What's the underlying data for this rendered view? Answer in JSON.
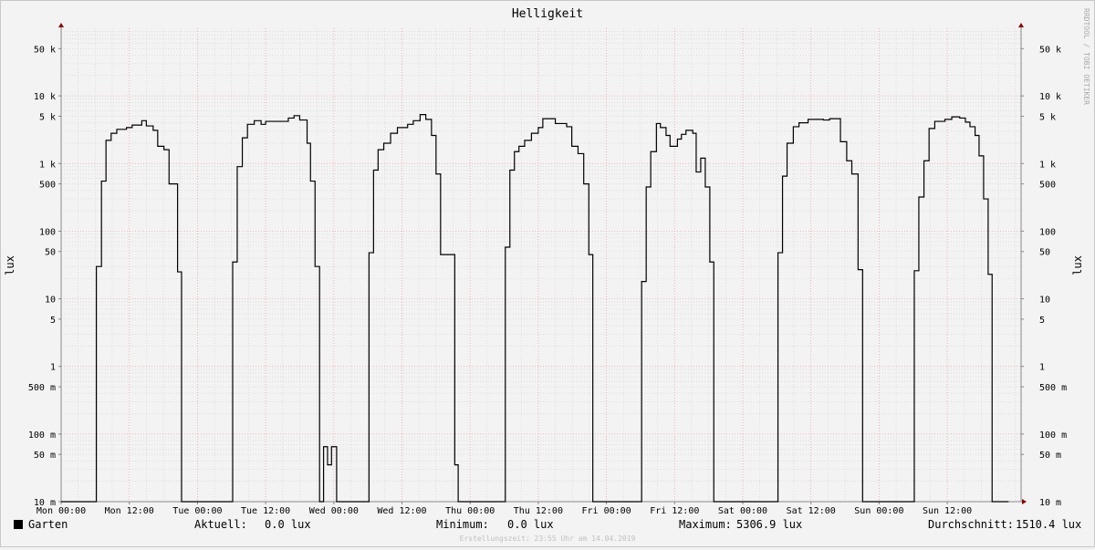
{
  "chart_data": {
    "type": "line",
    "title": "Helligkeit",
    "ylabel": "lux",
    "y_scale": "log",
    "ylim": [
      0.01,
      100000
    ],
    "y_ticks": [
      {
        "value": 0.01,
        "label": "10 m"
      },
      {
        "value": 0.05,
        "label": "50 m"
      },
      {
        "value": 0.1,
        "label": "100 m"
      },
      {
        "value": 0.5,
        "label": "500 m"
      },
      {
        "value": 1,
        "label": "1"
      },
      {
        "value": 5,
        "label": "5"
      },
      {
        "value": 10,
        "label": "10"
      },
      {
        "value": 50,
        "label": "50"
      },
      {
        "value": 100,
        "label": "100"
      },
      {
        "value": 500,
        "label": "500"
      },
      {
        "value": 1000,
        "label": "1 k"
      },
      {
        "value": 5000,
        "label": "5 k"
      },
      {
        "value": 10000,
        "label": "10 k"
      },
      {
        "value": 50000,
        "label": "50 k"
      }
    ],
    "x_ticks": [
      {
        "hours": 0,
        "label": "Mon 00:00"
      },
      {
        "hours": 12,
        "label": "Mon 12:00"
      },
      {
        "hours": 24,
        "label": "Tue 00:00"
      },
      {
        "hours": 36,
        "label": "Tue 12:00"
      },
      {
        "hours": 48,
        "label": "Wed 00:00"
      },
      {
        "hours": 60,
        "label": "Wed 12:00"
      },
      {
        "hours": 72,
        "label": "Thu 00:00"
      },
      {
        "hours": 84,
        "label": "Thu 12:00"
      },
      {
        "hours": 96,
        "label": "Fri 00:00"
      },
      {
        "hours": 108,
        "label": "Fri 12:00"
      },
      {
        "hours": 120,
        "label": "Sat 00:00"
      },
      {
        "hours": 132,
        "label": "Sat 12:00"
      },
      {
        "hours": 144,
        "label": "Sun 00:00"
      },
      {
        "hours": 156,
        "label": "Sun 12:00"
      }
    ],
    "xlim_hours": [
      0,
      169
    ],
    "grid": true,
    "series": [
      {
        "name": "Garten",
        "color": "#000000",
        "step": true,
        "points": [
          [
            0,
            0.01
          ],
          [
            6.2,
            0.01
          ],
          [
            6.2,
            30
          ],
          [
            7.1,
            30
          ],
          [
            7.1,
            550
          ],
          [
            7.9,
            550
          ],
          [
            7.9,
            2200
          ],
          [
            8.8,
            2200
          ],
          [
            8.8,
            2800
          ],
          [
            9.8,
            2800
          ],
          [
            9.8,
            3200
          ],
          [
            11.5,
            3200
          ],
          [
            11.5,
            3400
          ],
          [
            12.5,
            3400
          ],
          [
            12.5,
            3700
          ],
          [
            14.2,
            3700
          ],
          [
            14.2,
            4300
          ],
          [
            15.0,
            4300
          ],
          [
            15.0,
            3600
          ],
          [
            16.2,
            3600
          ],
          [
            16.2,
            3100
          ],
          [
            17.0,
            3100
          ],
          [
            17.0,
            1800
          ],
          [
            18.1,
            1800
          ],
          [
            18.1,
            1600
          ],
          [
            19.0,
            1600
          ],
          [
            19.0,
            500
          ],
          [
            20.5,
            500
          ],
          [
            20.5,
            25
          ],
          [
            21.2,
            25
          ],
          [
            21.2,
            0.01
          ],
          [
            30.2,
            0.01
          ],
          [
            30.2,
            35
          ],
          [
            31.0,
            35
          ],
          [
            31.0,
            900
          ],
          [
            31.9,
            900
          ],
          [
            31.9,
            2400
          ],
          [
            32.8,
            2400
          ],
          [
            32.8,
            3800
          ],
          [
            34.0,
            3800
          ],
          [
            34.0,
            4300
          ],
          [
            35.2,
            4300
          ],
          [
            35.2,
            3800
          ],
          [
            36.0,
            3800
          ],
          [
            36.0,
            4200
          ],
          [
            40.0,
            4200
          ],
          [
            40.0,
            4700
          ],
          [
            41.0,
            4700
          ],
          [
            41.0,
            5100
          ],
          [
            42.0,
            5100
          ],
          [
            42.0,
            4400
          ],
          [
            43.3,
            4400
          ],
          [
            43.3,
            2000
          ],
          [
            43.9,
            2000
          ],
          [
            43.9,
            550
          ],
          [
            44.7,
            550
          ],
          [
            44.7,
            30
          ],
          [
            45.5,
            30
          ],
          [
            45.5,
            0.01
          ],
          [
            46.2,
            0.01
          ],
          [
            46.2,
            0.065
          ],
          [
            46.9,
            0.065
          ],
          [
            46.9,
            0.035
          ],
          [
            47.6,
            0.035
          ],
          [
            47.6,
            0.065
          ],
          [
            48.5,
            0.065
          ],
          [
            48.5,
            0.01
          ],
          [
            54.2,
            0.01
          ],
          [
            54.2,
            48
          ],
          [
            55.0,
            48
          ],
          [
            55.0,
            800
          ],
          [
            55.8,
            800
          ],
          [
            55.8,
            1600
          ],
          [
            56.8,
            1600
          ],
          [
            56.8,
            2000
          ],
          [
            58.0,
            2000
          ],
          [
            58.0,
            2800
          ],
          [
            59.2,
            2800
          ],
          [
            59.2,
            3400
          ],
          [
            61.0,
            3400
          ],
          [
            61.0,
            3800
          ],
          [
            62.0,
            3800
          ],
          [
            62.0,
            4300
          ],
          [
            63.2,
            4300
          ],
          [
            63.2,
            5300
          ],
          [
            64.2,
            5300
          ],
          [
            64.2,
            4500
          ],
          [
            65.2,
            4500
          ],
          [
            65.2,
            2600
          ],
          [
            66.0,
            2600
          ],
          [
            66.0,
            700
          ],
          [
            66.8,
            700
          ],
          [
            66.8,
            45
          ],
          [
            69.3,
            45
          ],
          [
            69.3,
            0.035
          ],
          [
            69.9,
            0.035
          ],
          [
            69.9,
            0.01
          ],
          [
            78.2,
            0.01
          ],
          [
            78.2,
            58
          ],
          [
            79.0,
            58
          ],
          [
            79.0,
            800
          ],
          [
            79.8,
            800
          ],
          [
            79.8,
            1500
          ],
          [
            80.6,
            1500
          ],
          [
            80.6,
            1800
          ],
          [
            81.6,
            1800
          ],
          [
            81.6,
            2200
          ],
          [
            82.8,
            2200
          ],
          [
            82.8,
            2800
          ],
          [
            84.0,
            2800
          ],
          [
            84.0,
            3400
          ],
          [
            84.8,
            3400
          ],
          [
            84.8,
            4600
          ],
          [
            87.0,
            4600
          ],
          [
            87.0,
            3900
          ],
          [
            89.0,
            3900
          ],
          [
            89.0,
            3500
          ],
          [
            89.9,
            3500
          ],
          [
            89.9,
            1800
          ],
          [
            91.0,
            1800
          ],
          [
            91.0,
            1400
          ],
          [
            92.0,
            1400
          ],
          [
            92.0,
            500
          ],
          [
            92.9,
            500
          ],
          [
            92.9,
            45
          ],
          [
            93.6,
            45
          ],
          [
            93.6,
            0.01
          ],
          [
            102.2,
            0.01
          ],
          [
            102.2,
            18
          ],
          [
            103.0,
            18
          ],
          [
            103.0,
            450
          ],
          [
            103.8,
            450
          ],
          [
            103.8,
            1500
          ],
          [
            104.8,
            1500
          ],
          [
            104.8,
            3900
          ],
          [
            105.5,
            3900
          ],
          [
            105.5,
            3400
          ],
          [
            106.5,
            3400
          ],
          [
            106.5,
            2600
          ],
          [
            107.2,
            2600
          ],
          [
            107.2,
            1800
          ],
          [
            108.5,
            1800
          ],
          [
            108.5,
            2300
          ],
          [
            109.2,
            2300
          ],
          [
            109.2,
            2700
          ],
          [
            110.0,
            2700
          ],
          [
            110.0,
            3100
          ],
          [
            111.2,
            3100
          ],
          [
            111.2,
            2800
          ],
          [
            111.8,
            2800
          ],
          [
            111.8,
            750
          ],
          [
            112.6,
            750
          ],
          [
            112.6,
            1200
          ],
          [
            113.4,
            1200
          ],
          [
            113.4,
            450
          ],
          [
            114.2,
            450
          ],
          [
            114.2,
            35
          ],
          [
            114.9,
            35
          ],
          [
            114.9,
            0.01
          ],
          [
            126.2,
            0.01
          ],
          [
            126.2,
            48
          ],
          [
            127.0,
            48
          ],
          [
            127.0,
            650
          ],
          [
            127.8,
            650
          ],
          [
            127.8,
            2000
          ],
          [
            128.9,
            2000
          ],
          [
            128.9,
            3500
          ],
          [
            129.9,
            3500
          ],
          [
            129.9,
            4000
          ],
          [
            131.5,
            4000
          ],
          [
            131.5,
            4500
          ],
          [
            134.2,
            4500
          ],
          [
            134.2,
            4400
          ],
          [
            135.3,
            4400
          ],
          [
            135.3,
            4600
          ],
          [
            137.2,
            4600
          ],
          [
            137.2,
            2100
          ],
          [
            138.3,
            2100
          ],
          [
            138.3,
            1100
          ],
          [
            139.2,
            1100
          ],
          [
            139.2,
            700
          ],
          [
            140.3,
            700
          ],
          [
            140.3,
            27
          ],
          [
            141.1,
            27
          ],
          [
            141.1,
            0.01
          ],
          [
            150.2,
            0.01
          ],
          [
            150.2,
            26
          ],
          [
            151.0,
            26
          ],
          [
            151.0,
            320
          ],
          [
            151.9,
            320
          ],
          [
            151.9,
            1100
          ],
          [
            152.8,
            1100
          ],
          [
            152.8,
            3300
          ],
          [
            153.8,
            3300
          ],
          [
            153.8,
            4200
          ],
          [
            155.6,
            4200
          ],
          [
            155.6,
            4500
          ],
          [
            156.8,
            4500
          ],
          [
            156.8,
            4900
          ],
          [
            158.2,
            4900
          ],
          [
            158.2,
            4700
          ],
          [
            159.2,
            4700
          ],
          [
            159.2,
            4100
          ],
          [
            160.0,
            4100
          ],
          [
            160.0,
            3500
          ],
          [
            160.9,
            3500
          ],
          [
            160.9,
            2600
          ],
          [
            161.6,
            2600
          ],
          [
            161.6,
            1300
          ],
          [
            162.4,
            1300
          ],
          [
            162.4,
            300
          ],
          [
            163.2,
            300
          ],
          [
            163.2,
            23
          ],
          [
            163.9,
            23
          ],
          [
            163.9,
            0.01
          ],
          [
            166.8,
            0.01
          ]
        ]
      }
    ]
  },
  "legend": {
    "series_name": "Garten",
    "current_label": "Aktuell:",
    "current_value": "0.0 lux",
    "min_label": "Minimum:",
    "min_value": "0.0 lux",
    "max_label": "Maximum:",
    "max_value": "5306.9 lux",
    "avg_label": "Durchschnitt:",
    "avg_value": "1510.4 lux"
  },
  "watermark": "RRDTOOL / TOBI OETIKER",
  "footer": "Erstellungszeit: 23:55 Uhr am 14.04.2019",
  "colors": {
    "major_grid": "#f0a0a0",
    "minor_grid": "#d0d0d0",
    "line": "#000000",
    "axis": "#888888",
    "arrow": "#8b0000"
  }
}
